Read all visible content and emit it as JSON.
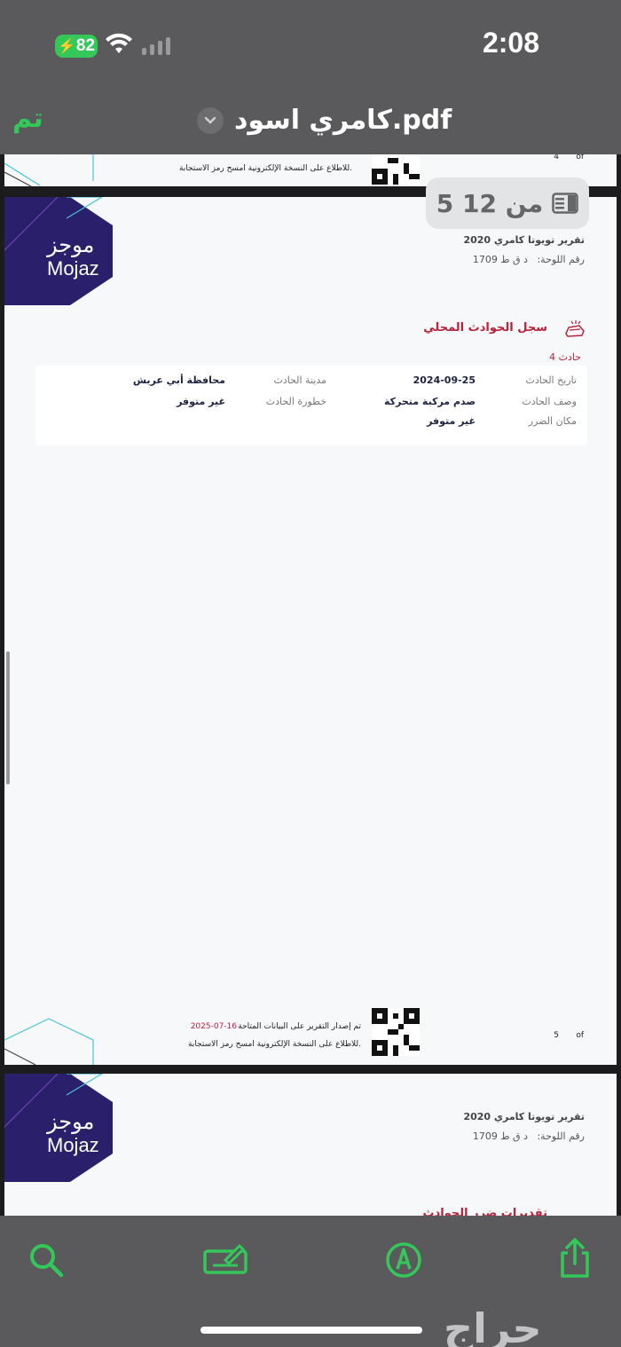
{
  "status_bar": {
    "battery": "82",
    "time": "2:08"
  },
  "nav": {
    "done_label": "تم",
    "title": "كامري اسود.pdf"
  },
  "page_indicator": "5 من 12",
  "prev_page_footer": {
    "scan_text": "للاطلاع على النسخة الإلكترونية امسح رمز الاستجابة.",
    "page_of": "of",
    "page_number": "4"
  },
  "page5": {
    "logo_ar": "موجز",
    "logo_en": "Mojaz",
    "report_title": "تقرير تويوتا كامري 2020",
    "plate_label": "رقم اللوحة:",
    "plate_value": "د ق ط 1709",
    "section_title": "سجل الحوادث المحلي",
    "accident_label": "حادث 4",
    "fields": {
      "date_label": "تاريخ الحادث",
      "date_value": "2024-09-25",
      "city_label": "مدينة الحادث",
      "city_value": "محافظة أبي عريش",
      "desc_label": "وصف الحادث",
      "desc_value": "صدم مركبة متحركة",
      "severity_label": "خطورة الحادث",
      "severity_value": "غير متوفر",
      "damage_label": "مكان الضرر",
      "damage_value": "غير متوفر"
    },
    "footer": {
      "issued_text": "تم إصدار التقرير على البيانات المتاحة",
      "issued_date": "2025-07-16",
      "scan_text": "للاطلاع على النسخة الإلكترونية امسح رمز الاستجابة.",
      "page_of": "of",
      "page_number": "5"
    }
  },
  "page6": {
    "logo_ar": "موجز",
    "logo_en": "Mojaz",
    "report_title": "تقرير تويوتا كامري 2020",
    "plate_label": "رقم اللوحة:",
    "plate_value": "د ق ط 1709",
    "section_title_partial": "تقديرات ضرر الحوادث"
  },
  "toolbar": {
    "icons": [
      "search-icon",
      "scan-signature-icon",
      "markup-pen-icon",
      "share-icon"
    ]
  },
  "watermark": "حراج",
  "colors": {
    "accent_green": "#34c759",
    "brand_purple": "#2a1f6b",
    "section_red": "#b5243c",
    "bar_gray": "#5a5a5c"
  }
}
